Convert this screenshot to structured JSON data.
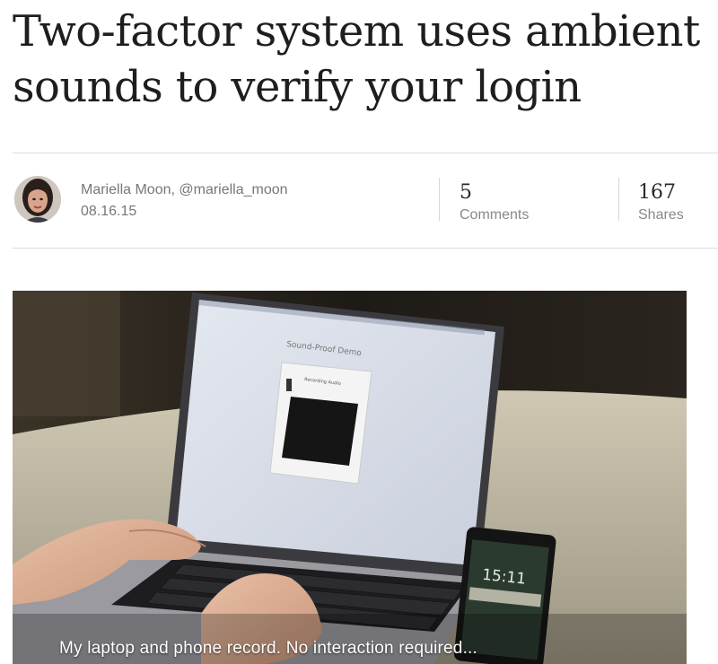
{
  "article": {
    "title": "Two-factor system uses ambient sounds to verify your login"
  },
  "byline": {
    "author": "Mariella Moon, @mariella_moon",
    "date": "08.16.15",
    "comments_count": "5",
    "comments_label": "Comments",
    "shares_count": "167",
    "shares_label": "Shares"
  },
  "media": {
    "screen_title": "Sound-Proof Demo",
    "screen_subtitle": "Recording Audio",
    "phone_time": "15:11",
    "caption": "My laptop and phone record. No interaction required..."
  }
}
